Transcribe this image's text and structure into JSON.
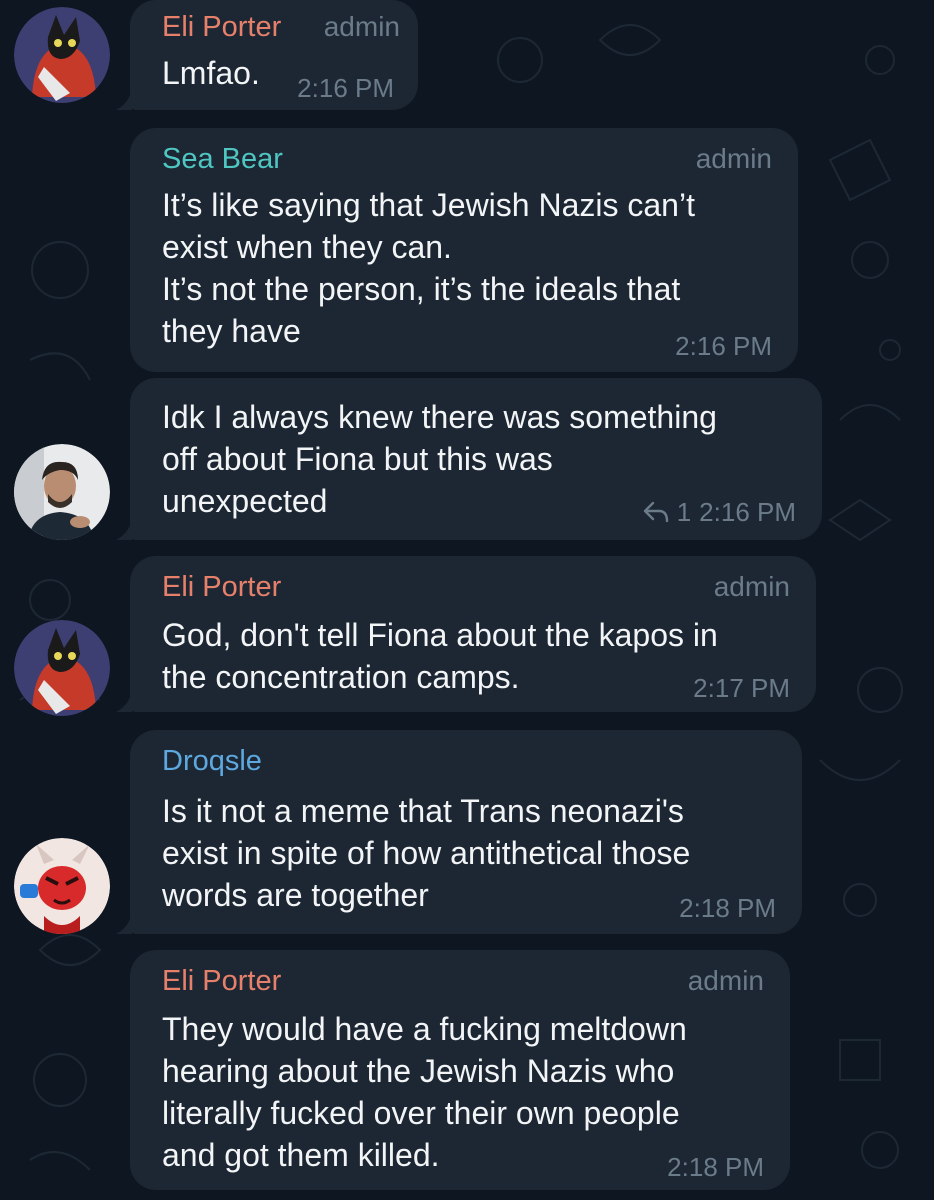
{
  "messages": [
    {
      "sender": "Eli Porter",
      "sender_color": "#e6806b",
      "role": "admin",
      "text": "Lmfao.",
      "time": "2:16 PM"
    },
    {
      "sender": "Sea Bear",
      "sender_color": "#4fc6c1",
      "role": "admin",
      "text": "It’s like saying that Jewish Nazis can’t\nexist when they can.\nIt’s not the person, it’s the ideals that\nthey have",
      "time": "2:16 PM"
    },
    {
      "text": "Idk I always knew there was something\noff about Fiona but this was\nunexpected",
      "reply_count": "1",
      "time": "2:16 PM"
    },
    {
      "sender": "Eli Porter",
      "sender_color": "#e6806b",
      "role": "admin",
      "text": "God, don't tell Fiona about the kapos in\nthe concentration camps.",
      "time": "2:17 PM"
    },
    {
      "sender": "Droqsle",
      "sender_color": "#5ea8e0",
      "text": "Is it not a meme that Trans neonazi's\nexist in spite of how antithetical those\nwords are together",
      "time": "2:18 PM"
    },
    {
      "sender": "Eli Porter",
      "sender_color": "#e6806b",
      "role": "admin",
      "text": "They would have a fucking meltdown\nhearing about the Jewish Nazis who\nliterally fucked over their own people\nand got them killed.",
      "time": "2:18 PM"
    }
  ],
  "colors": {
    "background": "#0e1621",
    "bubble": "#1c2733",
    "meta": "#6b7b8a",
    "text": "#f2f4f6"
  },
  "icons": {
    "reply": "reply-arrow-icon"
  }
}
